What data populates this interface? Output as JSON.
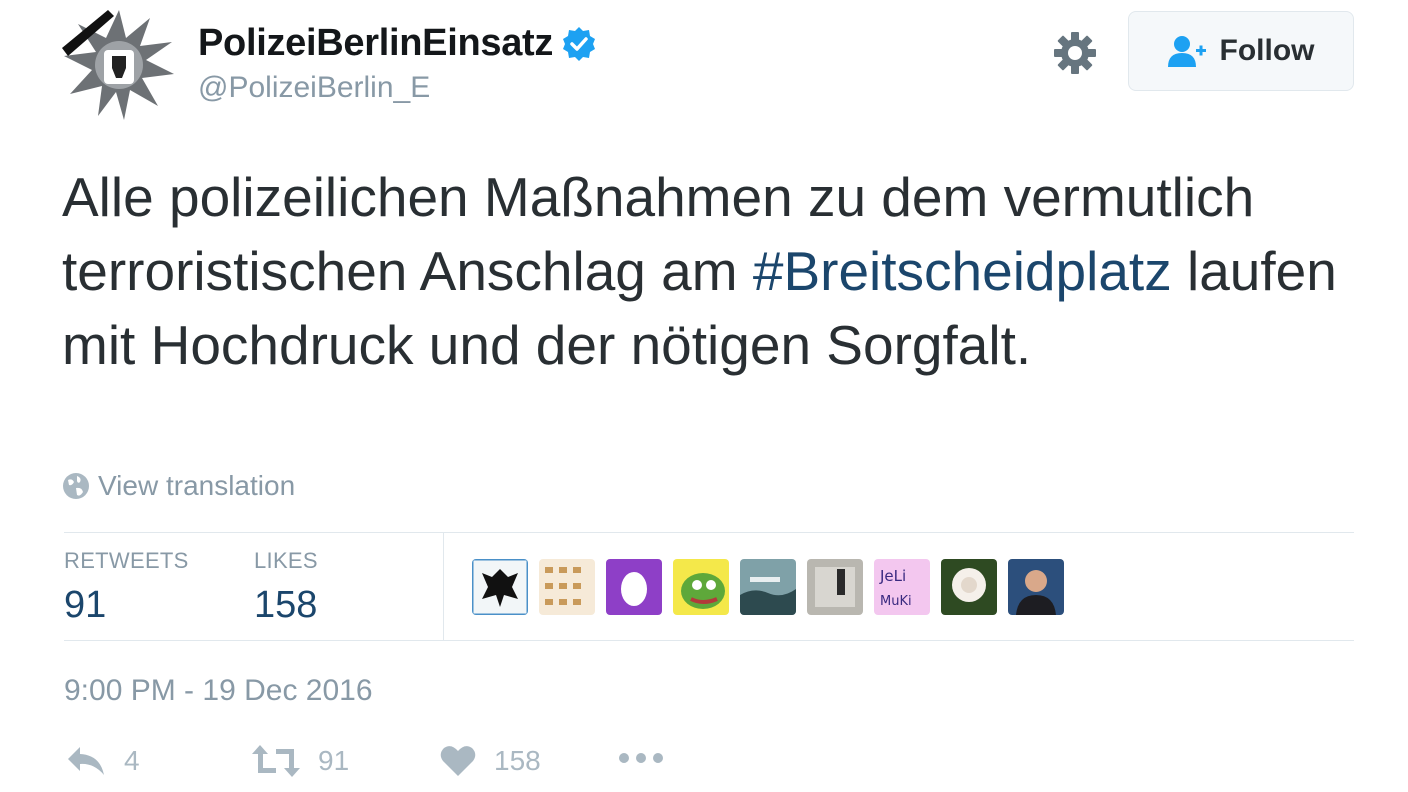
{
  "tweet": {
    "display_name": "PolizeiBerlinEinsatz",
    "handle": "@PolizeiBerlin_E",
    "follow_label": "Follow",
    "text_before": "Alle polizeilichen Maßnahmen zu dem vermutlich terroristischen Anschlag am ",
    "hashtag": "#Breitscheidplatz",
    "text_after": " laufen mit Hochdruck und der nötigen Sorgfalt.",
    "view_translation": "View translation",
    "retweets_label": "RETWEETS",
    "retweets_count": "91",
    "likes_label": "LIKES",
    "likes_count": "158",
    "timestamp": "9:00 PM - 19 Dec 2016",
    "reply_count": "4",
    "retweet_action_count": "91",
    "like_action_count": "158"
  },
  "icons": {
    "verified": "verified-badge-icon",
    "settings": "gear-icon",
    "follow": "add-user-icon",
    "globe": "globe-icon",
    "reply": "reply-icon",
    "retweet": "retweet-icon",
    "like": "heart-icon",
    "more": "more-dots-icon"
  },
  "colors": {
    "verified": "#1da1f2",
    "hashtag": "#1b466c",
    "muted": "#8899a6",
    "text": "#292f33",
    "follow_icon": "#1da1f2"
  },
  "likers": [
    {
      "avatar": "eagle-crest"
    },
    {
      "avatar": "text-pattern"
    },
    {
      "avatar": "default-egg"
    },
    {
      "avatar": "pepe-frog"
    },
    {
      "avatar": "landscape"
    },
    {
      "avatar": "room-photo"
    },
    {
      "avatar": "pink-handwriting"
    },
    {
      "avatar": "white-rose"
    },
    {
      "avatar": "man-portrait"
    }
  ]
}
